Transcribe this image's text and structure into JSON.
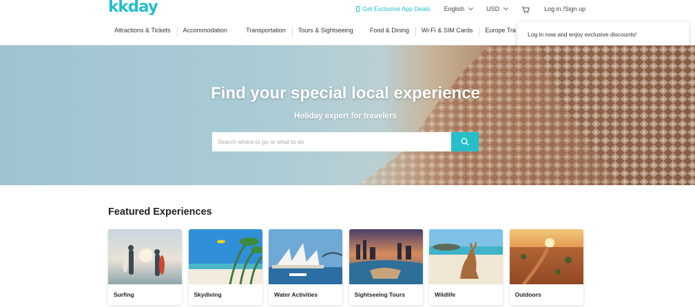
{
  "brand": {
    "logo_text": "kkday",
    "accent": "#26bec9"
  },
  "topbar": {
    "app_deals": "Get Exclusive App Deals",
    "language": "English",
    "currency": "USD",
    "login": "Log in /Sign up"
  },
  "nav": {
    "items": [
      "Attractions & Tickets",
      "Accommodation",
      "Transportation",
      "Tours & Sightseeing",
      "Food & Dining",
      "Wi-Fi & SIM Cards",
      "Europe Tra"
    ]
  },
  "login_popup": {
    "text": "Log in now and enjoy exclusive discounts!"
  },
  "hero": {
    "title": "Find your special local experience",
    "subtitle": "Holiday expert for travelers",
    "search_placeholder": "Search where to go or what to do"
  },
  "featured": {
    "title": "Featured Experiences",
    "cards": [
      {
        "label": "Surfing"
      },
      {
        "label": "Skydiving"
      },
      {
        "label": "Water Activities"
      },
      {
        "label": "Sightseeing Tours"
      },
      {
        "label": "Wildlife"
      },
      {
        "label": "Outdoors"
      }
    ]
  }
}
